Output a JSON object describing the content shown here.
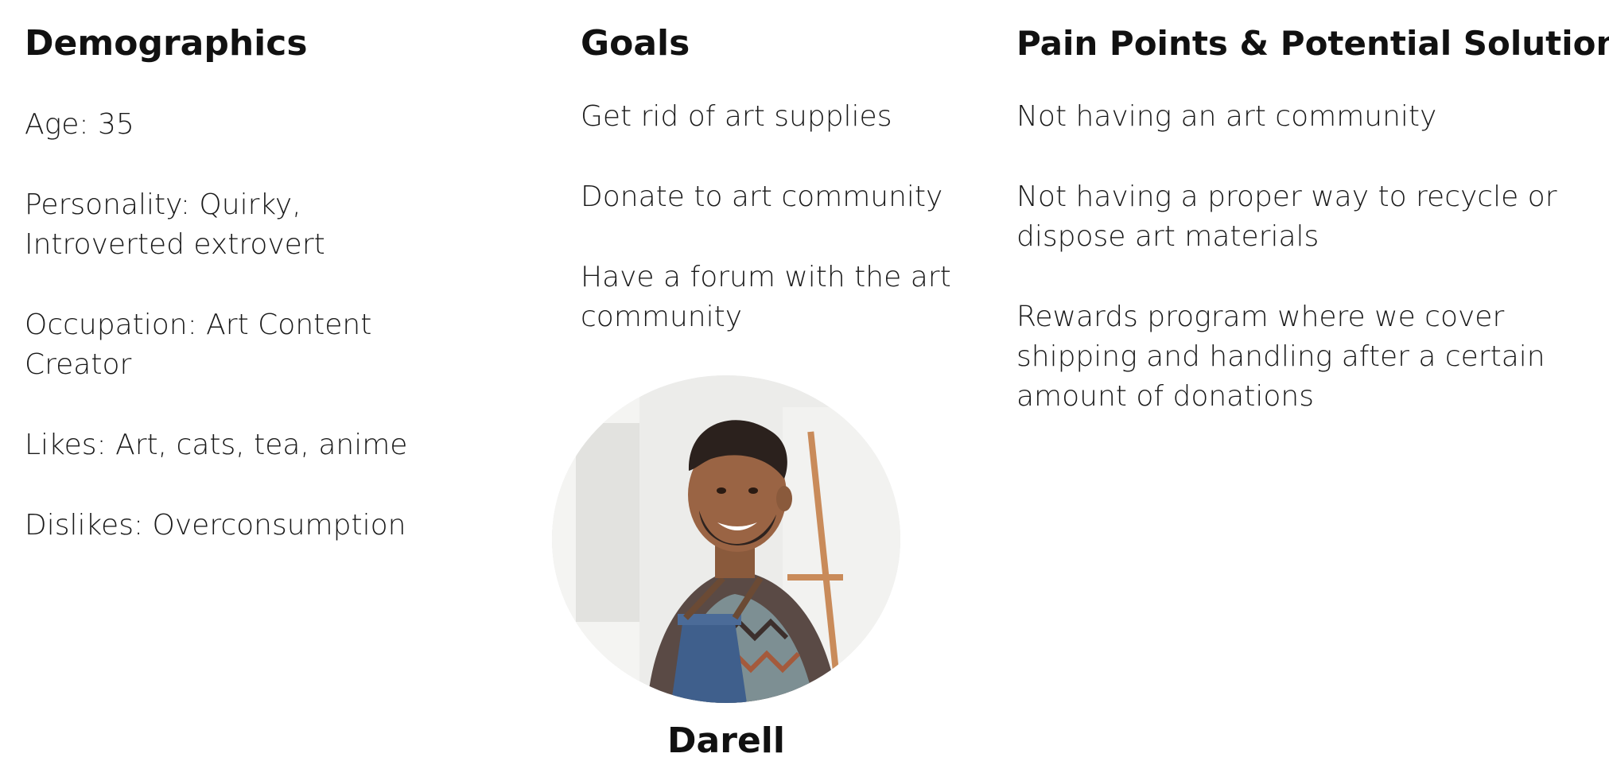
{
  "demographics": {
    "heading": "Demographics",
    "items": [
      "Age: 35",
      "Personality: Quirky, Introverted extrovert",
      "Occupation: Art Content Creator",
      "Likes: Art, cats, tea, anime",
      "Dislikes: Overconsumption"
    ]
  },
  "goals": {
    "heading": "Goals",
    "items": [
      "Get rid of art supplies",
      "Donate to art community",
      "Have a forum with the art community"
    ]
  },
  "pain_points": {
    "heading": "Pain Points & Potential Solutions",
    "items": [
      "Not having an art community",
      "Not having a proper way to recycle or dispose art materials",
      "Rewards program where we cover shipping and handling after a certain amount of donations"
    ]
  },
  "persona": {
    "name": "Darell",
    "photo_icon": "persona-portrait-photo"
  }
}
